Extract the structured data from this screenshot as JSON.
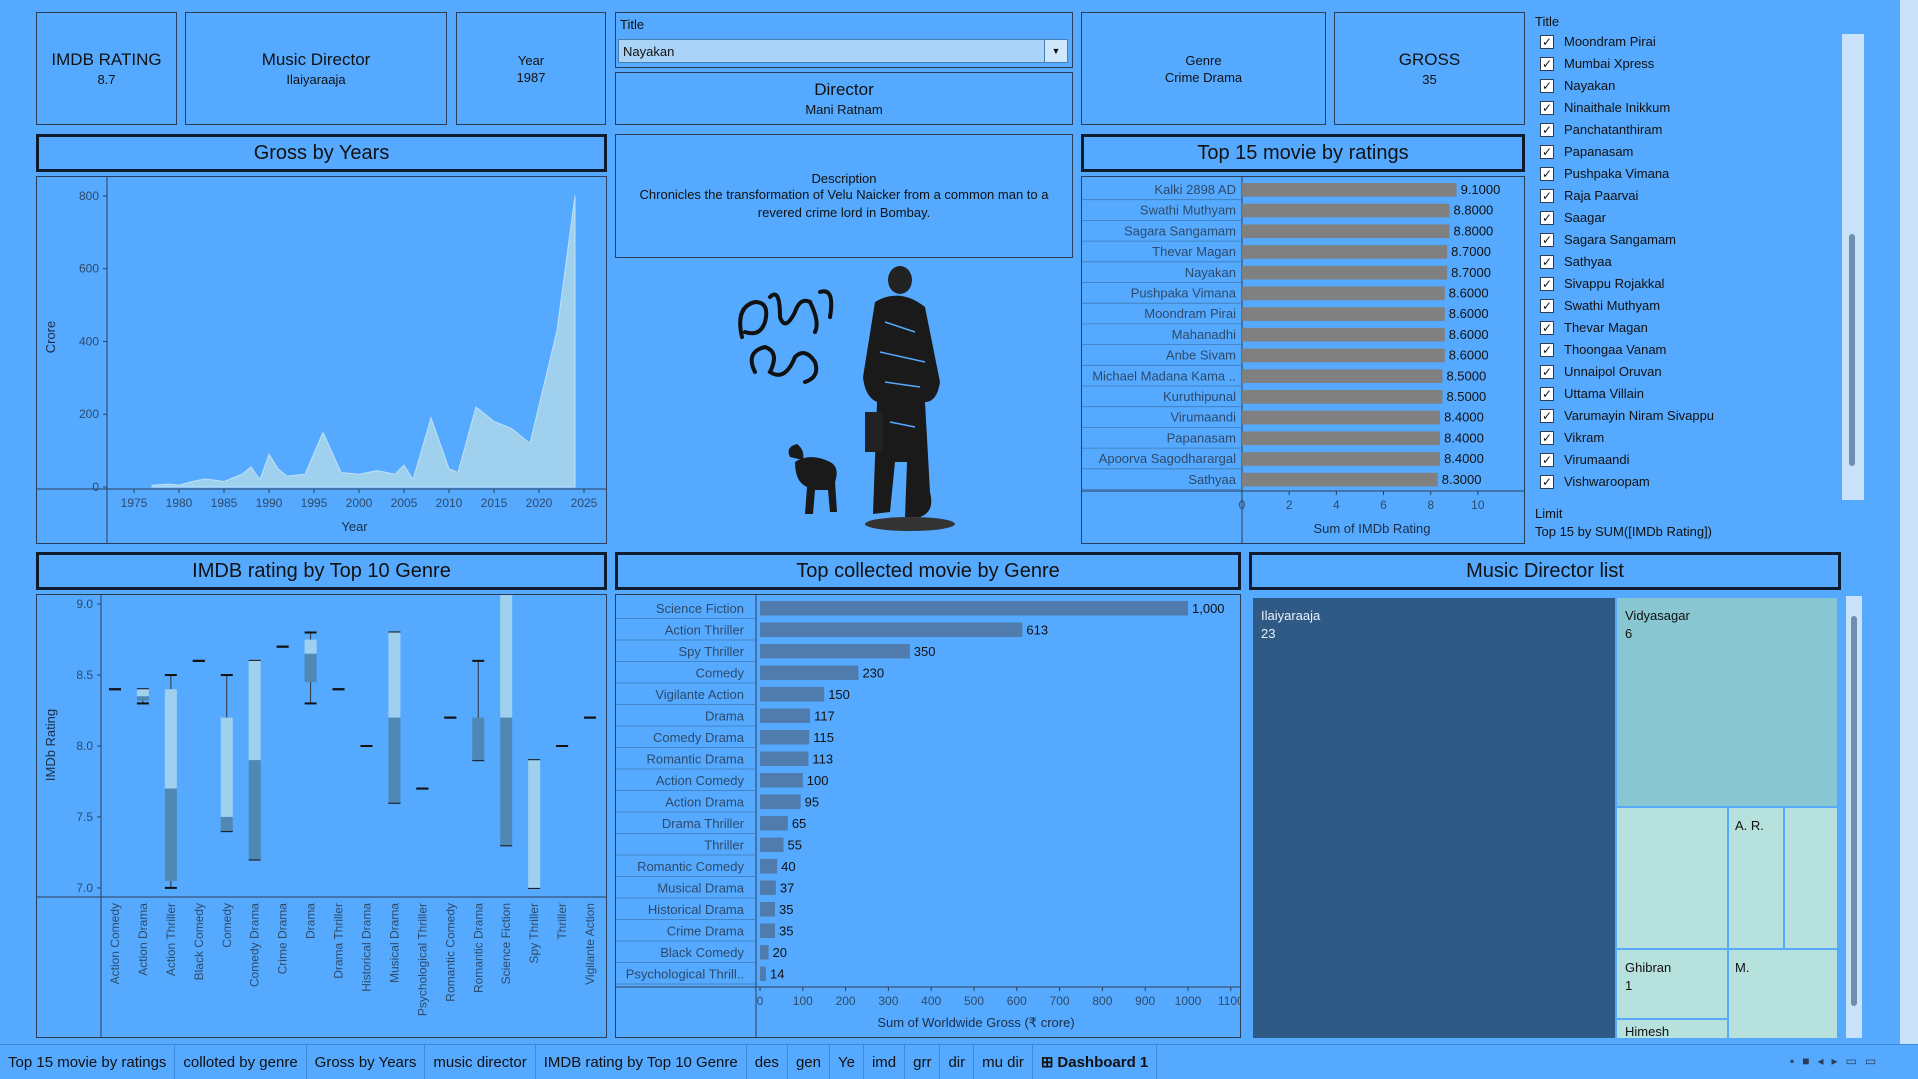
{
  "kpis": {
    "imdb": {
      "label": "IMDB RATING",
      "value": "8.7"
    },
    "music": {
      "label": "Music Director",
      "value": "Ilaiyaraaja"
    },
    "year": {
      "label": "Year",
      "value": "1987"
    },
    "genre": {
      "label": "Genre",
      "value": "Crime Drama"
    },
    "gross": {
      "label": "GROSS",
      "value": "35"
    },
    "director": {
      "label": "Director",
      "value": "Mani Ratnam"
    }
  },
  "title_filter": {
    "label": "Title",
    "selected": "Nayakan"
  },
  "description": {
    "label": "Description",
    "text": "Chronicles the transformation of Velu Naicker from a common man to a revered crime lord in Bombay."
  },
  "panel_titles": {
    "gross_by_years": "Gross by Years",
    "top15": "Top 15 movie by ratings",
    "imdb_genre": "IMDB rating by Top 10 Genre",
    "top_collected": "Top collected movie by Genre",
    "music_list": "Music Director list"
  },
  "title_list": {
    "header": "Title",
    "items": [
      "Moondram Pirai",
      "Mumbai Xpress",
      "Nayakan",
      "Ninaithale Inikkum",
      "Panchatanthiram",
      "Papanasam",
      "Pushpaka Vimana",
      "Raja Paarvai",
      "Saagar",
      "Sagara Sangamam",
      "Sathyaa",
      "Sivappu Rojakkal",
      "Swathi Muthyam",
      "Thevar Magan",
      "Thoongaa Vanam",
      "Unnaipol Oruvan",
      "Uttama Villain",
      "Varumayin Niram Sivappu",
      "Vikram",
      "Virumaandi",
      "Vishwaroopam"
    ],
    "check": "✓",
    "limit_label": "Limit",
    "limit_value": "Top 15 by SUM([IMDb Rating])"
  },
  "colors": {
    "background": "#55aaff",
    "area": "#9fd1ee",
    "bar_gray": "#808080",
    "bar_blue": "#4f7cac",
    "treemap_dark": "#2f5a86",
    "treemap_light": "#88c6d1",
    "treemap_pale": "#b7e1dc"
  },
  "chart_data": [
    {
      "id": "gross_by_years",
      "type": "area",
      "xlabel": "Year",
      "ylabel": "Crore",
      "xlim": [
        1972,
        2027
      ],
      "ylim": [
        0,
        830
      ],
      "x_ticks": [
        1975,
        1980,
        1985,
        1990,
        1995,
        2000,
        2005,
        2010,
        2015,
        2020,
        2025
      ],
      "y_ticks": [
        0,
        200,
        400,
        600,
        800
      ],
      "x": [
        1977,
        1979,
        1980,
        1981,
        1982,
        1983,
        1985,
        1987,
        1988,
        1989,
        1990,
        1991,
        1992,
        1994,
        1996,
        1998,
        2000,
        2002,
        2004,
        2005,
        2006,
        2008,
        2010,
        2011,
        2013,
        2015,
        2017,
        2019,
        2022,
        2024
      ],
      "values": [
        5,
        8,
        5,
        12,
        18,
        22,
        15,
        35,
        55,
        20,
        90,
        50,
        30,
        35,
        150,
        40,
        35,
        45,
        35,
        60,
        20,
        190,
        50,
        40,
        220,
        180,
        160,
        120,
        430,
        800
      ]
    },
    {
      "id": "top15",
      "type": "bar",
      "xlabel": "Sum of IMDb Rating",
      "ylabel": "",
      "xlim": [
        0,
        11.5
      ],
      "x_ticks": [
        0,
        2,
        4,
        6,
        8,
        10
      ],
      "categories": [
        "Kalki 2898 AD",
        "Swathi Muthyam",
        "Sagara Sangamam",
        "Thevar Magan",
        "Nayakan",
        "Pushpaka Vimana",
        "Moondram Pirai",
        "Mahanadhi",
        "Anbe Sivam",
        "Michael Madana Kama ..",
        "Kuruthipunal",
        "Virumaandi",
        "Papanasam",
        "Apoorva Sagodharargal",
        "Sathyaa"
      ],
      "values": [
        9.1,
        8.8,
        8.8,
        8.7,
        8.7,
        8.6,
        8.6,
        8.6,
        8.6,
        8.5,
        8.5,
        8.4,
        8.4,
        8.4,
        8.3
      ],
      "labels": [
        "9.1000",
        "8.8000",
        "8.8000",
        "8.7000",
        "8.7000",
        "8.6000",
        "8.6000",
        "8.6000",
        "8.6000",
        "8.5000",
        "8.5000",
        "8.4000",
        "8.4000",
        "8.4000",
        "8.3000"
      ]
    },
    {
      "id": "imdb_genre",
      "type": "box",
      "ylabel": "IMDb Rating",
      "ylim": [
        6.95,
        9.05
      ],
      "y_ticks": [
        "9.0",
        "8.5",
        "8.0",
        "7.5",
        "7.0"
      ],
      "categories": [
        "Action Comedy",
        "Action Drama",
        "Action Thriller",
        "Black Comedy",
        "Comedy",
        "Comedy Drama",
        "Crime Drama",
        "Drama",
        "Drama Thriller",
        "Historical Drama",
        "Musical Drama",
        "Psychological Thriller",
        "Romantic Comedy",
        "Romantic Drama",
        "Science Fiction",
        "Spy Thriller",
        "Thriller",
        "Vigilante Action"
      ],
      "boxes": [
        {
          "min": 8.4,
          "q1": 8.4,
          "med": 8.4,
          "q3": 8.4,
          "max": 8.4
        },
        {
          "min": 8.3,
          "q1": 8.32,
          "med": 8.35,
          "q3": 8.4,
          "max": 8.4
        },
        {
          "min": 7.0,
          "q1": 7.05,
          "med": 7.7,
          "q3": 8.4,
          "max": 8.5
        },
        {
          "min": 8.6,
          "q1": 8.6,
          "med": 8.6,
          "q3": 8.6,
          "max": 8.6
        },
        {
          "min": 7.4,
          "q1": 7.4,
          "med": 7.5,
          "q3": 8.2,
          "max": 8.5
        },
        {
          "min": 7.2,
          "q1": 7.2,
          "med": 7.9,
          "q3": 8.6,
          "max": 8.6
        },
        {
          "min": 8.7,
          "q1": 8.7,
          "med": 8.7,
          "q3": 8.7,
          "max": 8.7
        },
        {
          "min": 8.3,
          "q1": 8.45,
          "med": 8.65,
          "q3": 8.75,
          "max": 8.8
        },
        {
          "min": 8.4,
          "q1": 8.4,
          "med": 8.4,
          "q3": 8.4,
          "max": 8.4
        },
        {
          "min": 8.0,
          "q1": 8.0,
          "med": 8.0,
          "q3": 8.0,
          "max": 8.0
        },
        {
          "min": 7.6,
          "q1": 7.6,
          "med": 8.2,
          "q3": 8.8,
          "max": 8.8
        },
        {
          "min": 7.7,
          "q1": 7.7,
          "med": 7.7,
          "q3": 7.7,
          "max": 7.7
        },
        {
          "min": 8.2,
          "q1": 8.2,
          "med": 8.2,
          "q3": 8.2,
          "max": 8.2
        },
        {
          "min": 7.9,
          "q1": 7.9,
          "med": 8.2,
          "q3": 8.2,
          "max": 8.6
        },
        {
          "min": 7.3,
          "q1": 7.3,
          "med": 8.2,
          "q3": 9.1,
          "max": 9.1
        },
        {
          "min": 7.0,
          "q1": 7.0,
          "med": 7.0,
          "q3": 7.9,
          "max": 7.9
        },
        {
          "min": 8.0,
          "q1": 8.0,
          "med": 8.0,
          "q3": 8.0,
          "max": 8.0
        },
        {
          "min": 8.2,
          "q1": 8.2,
          "med": 8.2,
          "q3": 8.2,
          "max": 8.2
        }
      ]
    },
    {
      "id": "top_collected",
      "type": "bar",
      "xlabel": "Sum of Worldwide Gross (₹ crore)",
      "ylabel": "",
      "xlim": [
        0,
        1150
      ],
      "x_ticks": [
        0,
        100,
        200,
        300,
        400,
        500,
        600,
        700,
        800,
        900,
        1000,
        1100
      ],
      "categories": [
        "Science Fiction",
        "Action Thriller",
        "Spy Thriller",
        "Comedy",
        "Vigilante Action",
        "Drama",
        "Comedy Drama",
        "Romantic Drama",
        "Action Comedy",
        "Action Drama",
        "Drama Thriller",
        "Thriller",
        "Romantic Comedy",
        "Musical Drama",
        "Historical Drama",
        "Crime Drama",
        "Black Comedy",
        "Psychological Thrill.."
      ],
      "values": [
        1000,
        613,
        350,
        230,
        150,
        117,
        115,
        113,
        100,
        95,
        65,
        55,
        40,
        37,
        35,
        35,
        20,
        14
      ],
      "labels": [
        "1,000",
        "613",
        "350",
        "230",
        "150",
        "117",
        "115",
        "113",
        "100",
        "95",
        "65",
        "55",
        "40",
        "37",
        "35",
        "35",
        "20",
        "14"
      ]
    },
    {
      "id": "music_list",
      "type": "treemap",
      "items": [
        {
          "name": "Ilaiyaraaja",
          "value": 23
        },
        {
          "name": "Vidyasagar",
          "value": 6
        },
        {
          "name": "A. R.",
          "value": null
        },
        {
          "name": "Ghibran",
          "value": 1
        },
        {
          "name": "M.",
          "value": null
        },
        {
          "name": "Himesh",
          "value": null
        }
      ]
    }
  ],
  "tabs": [
    "Top 15 movie by ratings",
    "colloted by genre",
    "Gross by Years",
    "music director",
    "IMDB rating by Top 10 Genre",
    "des",
    "gen",
    "Ye",
    "imd",
    "grr",
    "dir",
    "mu dir",
    "Dashboard 1"
  ],
  "dashboard_icon": "⊞"
}
